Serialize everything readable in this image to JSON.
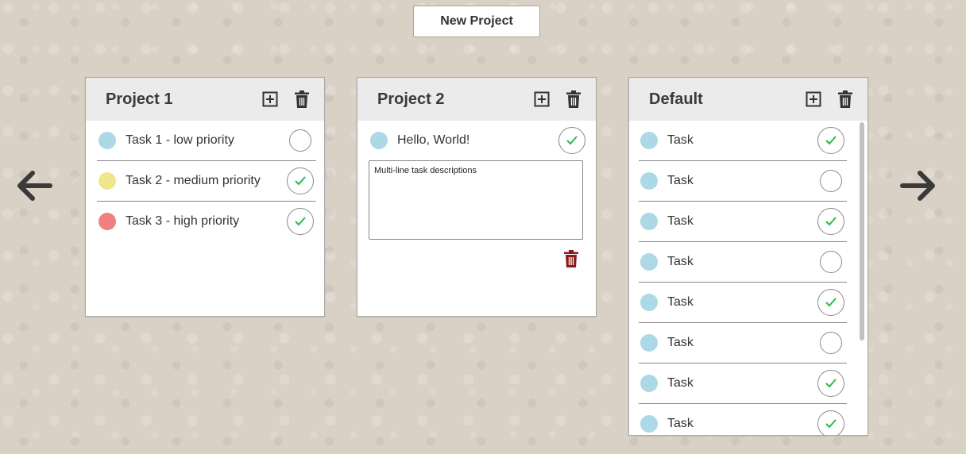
{
  "toolbar": {
    "new_project_label": "New Project"
  },
  "nav": {
    "prev_icon": "arrow-left-icon",
    "next_icon": "arrow-right-icon"
  },
  "colors": {
    "priority_low": "#add8e6",
    "priority_medium": "#f0e68c",
    "priority_high": "#f08080",
    "check": "#2db84d",
    "delete_task": "#8b1a1a",
    "card_header_bg": "#ebebeb",
    "page_bg": "#d9d1c5"
  },
  "projects": [
    {
      "title": "Project 1",
      "add_icon": "plus-square-icon",
      "delete_icon": "trash-icon",
      "tasks": [
        {
          "label": "Task 1 - low priority",
          "priority": "low",
          "completed": false
        },
        {
          "label": "Task 2 - medium priority",
          "priority": "medium",
          "completed": true
        },
        {
          "label": "Task 3 - high priority",
          "priority": "high",
          "completed": true
        }
      ]
    },
    {
      "title": "Project 2",
      "add_icon": "plus-square-icon",
      "delete_icon": "trash-icon",
      "tasks": [
        {
          "label": "Hello, World!",
          "priority": "low",
          "completed": true,
          "expanded": true,
          "description": "Multi-line task descriptions"
        }
      ]
    },
    {
      "title": "Default",
      "add_icon": "plus-square-icon",
      "delete_icon": "trash-icon",
      "tasks": [
        {
          "label": "Task",
          "priority": "low",
          "completed": true
        },
        {
          "label": "Task",
          "priority": "low",
          "completed": false
        },
        {
          "label": "Task",
          "priority": "low",
          "completed": true
        },
        {
          "label": "Task",
          "priority": "low",
          "completed": false
        },
        {
          "label": "Task",
          "priority": "low",
          "completed": true
        },
        {
          "label": "Task",
          "priority": "low",
          "completed": false
        },
        {
          "label": "Task",
          "priority": "low",
          "completed": true
        },
        {
          "label": "Task",
          "priority": "low",
          "completed": true
        }
      ]
    }
  ]
}
